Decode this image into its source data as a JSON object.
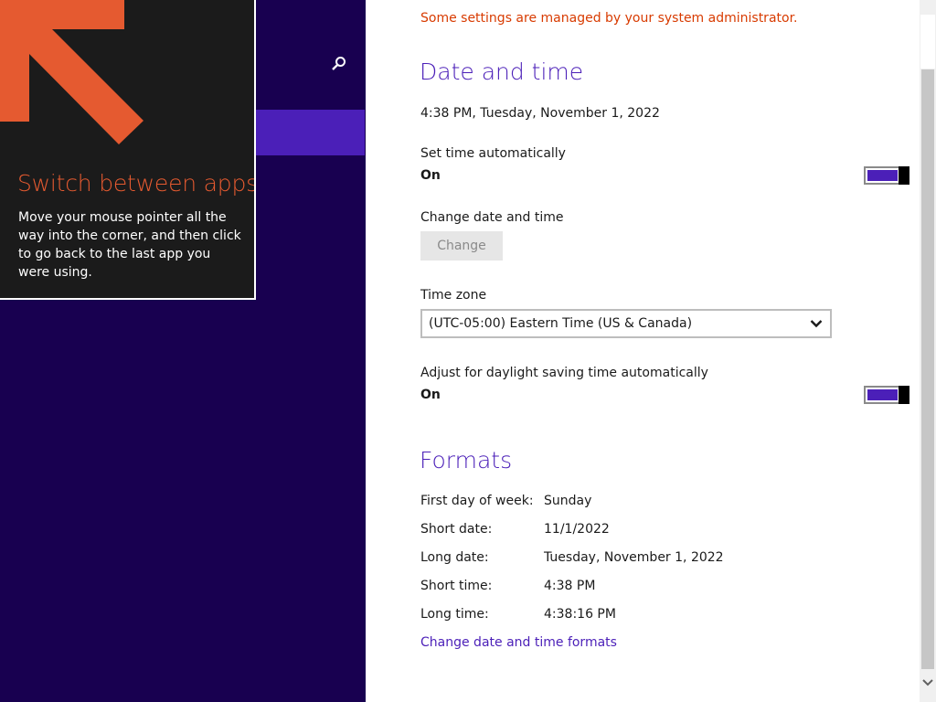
{
  "tip": {
    "title": "Switch between apps",
    "body": "Move your mouse pointer all the way into the corner, and then click to go back to the last app you were using.",
    "accent_color": "#e55a30"
  },
  "left_pane": {
    "search_icon": "search-icon",
    "background_color": "#180050",
    "selected_color": "#4b1fb8"
  },
  "admin_note": "Some settings are managed by your system administrator.",
  "date_time": {
    "title": "Date and time",
    "current": "4:38 PM, Tuesday, November 1, 2022",
    "set_auto_label": "Set time automatically",
    "set_auto_state": "On",
    "change_label": "Change date and time",
    "change_button": "Change",
    "timezone_label": "Time zone",
    "timezone_value": "(UTC-05:00) Eastern Time (US & Canada)",
    "dst_label": "Adjust for daylight saving time automatically",
    "dst_state": "On"
  },
  "formats": {
    "title": "Formats",
    "rows": [
      {
        "label": "First day of week:",
        "value": "Sunday"
      },
      {
        "label": "Short date:",
        "value": "11/1/2022"
      },
      {
        "label": "Long date:",
        "value": "Tuesday, November 1, 2022"
      },
      {
        "label": "Short time:",
        "value": "4:38 PM"
      },
      {
        "label": "Long time:",
        "value": "4:38:16 PM"
      }
    ],
    "link": "Change date and time formats"
  },
  "colors": {
    "accent": "#4b1fb8",
    "warning": "#d83b01"
  }
}
